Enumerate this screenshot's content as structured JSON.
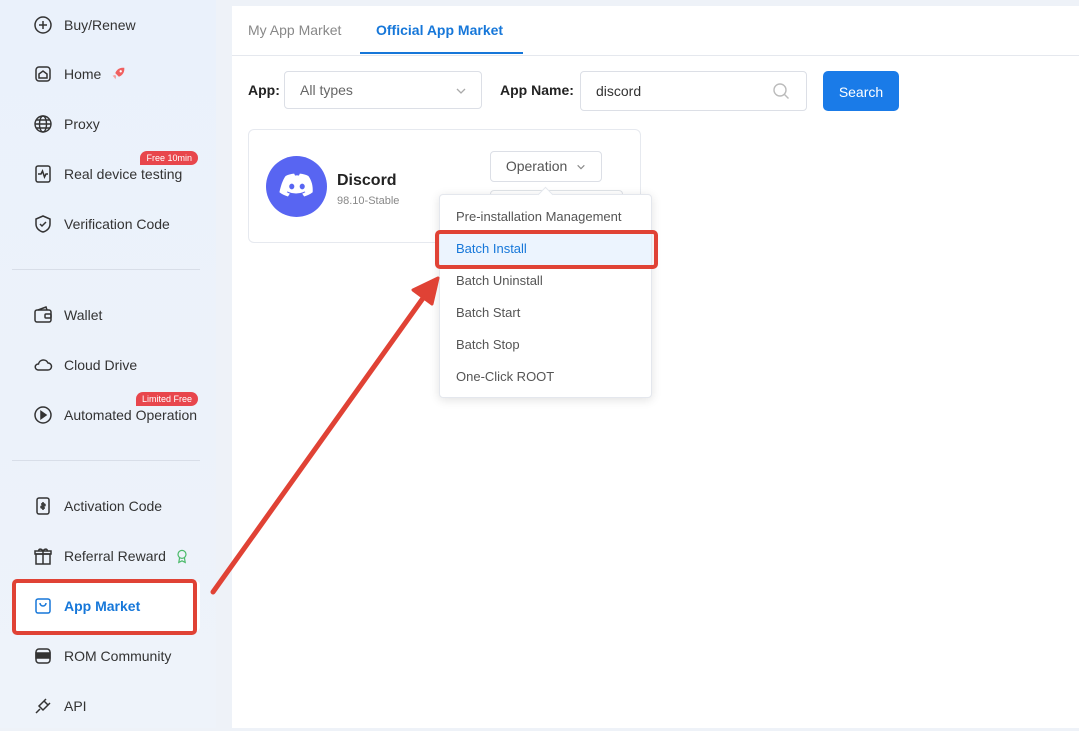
{
  "sidebar": {
    "items": [
      {
        "label": "Buy/Renew",
        "icon": "plus-circle-icon"
      },
      {
        "label": "Home",
        "icon": "home-icon"
      },
      {
        "label": "Proxy",
        "icon": "globe-icon"
      },
      {
        "label": "Real device testing",
        "icon": "pulse-icon",
        "badge": "Free 10min"
      },
      {
        "label": "Verification Code",
        "icon": "shield-check-icon"
      },
      {
        "label": "Wallet",
        "icon": "wallet-icon"
      },
      {
        "label": "Cloud Drive",
        "icon": "cloud-icon"
      },
      {
        "label": "Automated Operation",
        "icon": "play-circle-icon",
        "badge": "Limited Free"
      },
      {
        "label": "Activation Code",
        "icon": "activation-code-icon"
      },
      {
        "label": "Referral Reward",
        "icon": "gift-icon"
      },
      {
        "label": "App Market",
        "icon": "app-market-icon",
        "active": true
      },
      {
        "label": "ROM Community",
        "icon": "rom-icon"
      },
      {
        "label": "API",
        "icon": "api-plug-icon"
      }
    ]
  },
  "tabs": [
    {
      "label": "My App Market",
      "active": false
    },
    {
      "label": "Official App Market",
      "active": true
    }
  ],
  "filters": {
    "app_label": "App:",
    "app_select_value": "All types",
    "name_label": "App Name:",
    "name_value": "discord",
    "search_label": "Search"
  },
  "app_card": {
    "name": "Discord",
    "version": "98.10-Stable",
    "operation_label": "Operation"
  },
  "dropdown": {
    "items": [
      {
        "label": "Pre-installation Management"
      },
      {
        "label": "Batch Install",
        "highlighted": true
      },
      {
        "label": "Batch Uninstall"
      },
      {
        "label": "Batch Start"
      },
      {
        "label": "Batch Stop"
      },
      {
        "label": "One-Click ROOT"
      }
    ]
  },
  "colors": {
    "accent": "#1677d9",
    "annotation": "#e04235",
    "discord": "#5865f2",
    "badge": "#e8464c"
  }
}
